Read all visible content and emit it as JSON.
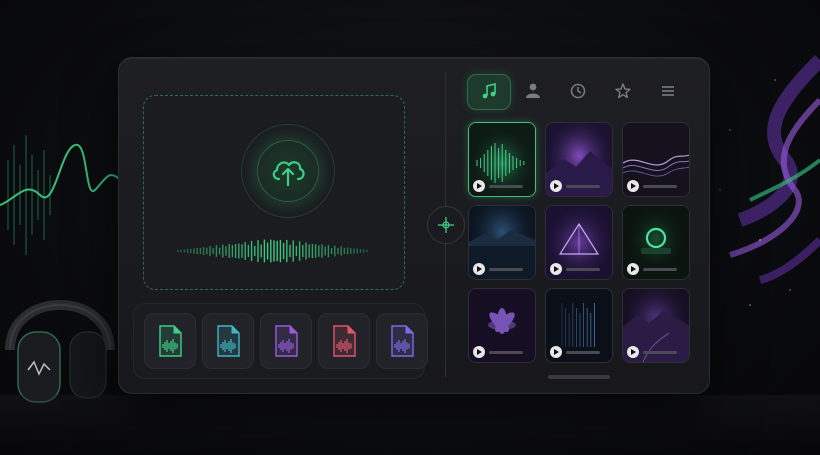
{
  "tabs": [
    {
      "icon": "music-note-icon",
      "active": true
    },
    {
      "icon": "user-icon",
      "active": false
    },
    {
      "icon": "clock-icon",
      "active": false
    },
    {
      "icon": "star-icon",
      "active": false
    },
    {
      "icon": "menu-icon",
      "active": false
    }
  ],
  "upload": {
    "icon": "cloud-upload-icon"
  },
  "file_chips": [
    {
      "icon": "audio-file-icon",
      "color": "#3ecf86"
    },
    {
      "icon": "audio-file-icon",
      "color": "#3fb6c8"
    },
    {
      "icon": "audio-file-icon",
      "color": "#9a5be0"
    },
    {
      "icon": "audio-file-icon",
      "color": "#e0566a"
    },
    {
      "icon": "audio-file-icon",
      "color": "#7b6ce8"
    }
  ],
  "cards": [
    {
      "theme": "green-waveform",
      "selected": true
    },
    {
      "theme": "purple-mountains",
      "selected": false
    },
    {
      "theme": "violet-waves",
      "selected": false
    },
    {
      "theme": "blue-lake",
      "selected": false
    },
    {
      "theme": "purple-pyramid",
      "selected": false
    },
    {
      "theme": "green-ring",
      "selected": false
    },
    {
      "theme": "purple-lotus",
      "selected": false
    },
    {
      "theme": "blue-light-beams",
      "selected": false
    },
    {
      "theme": "purple-valley",
      "selected": false
    }
  ],
  "colors": {
    "accent": "#3ecf86",
    "panel": "#1c1d21",
    "purple": "#8a4fd8"
  }
}
